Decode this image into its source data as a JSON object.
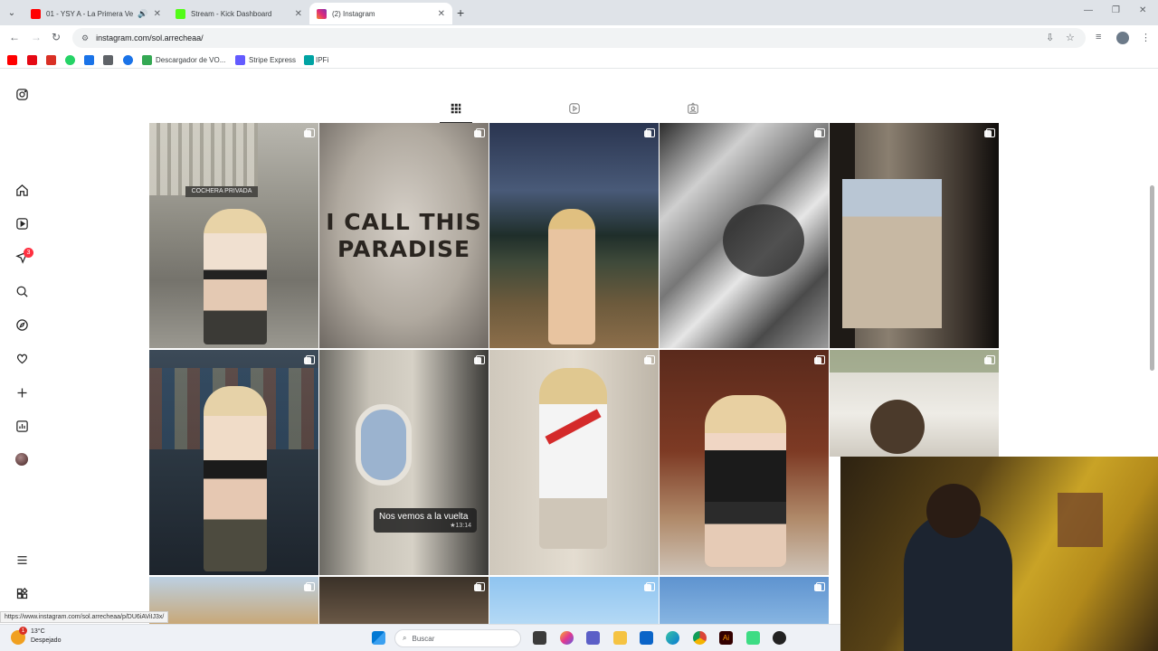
{
  "browser": {
    "tabs": [
      {
        "title": "01 - YSY A - La Primera Ve",
        "active": false,
        "favicon_color": "#ff0000"
      },
      {
        "title": "Stream - Kick Dashboard",
        "active": false,
        "favicon_color": "#53fc18"
      },
      {
        "title": "(2) Instagram",
        "active": true,
        "favicon_color": "#e1306c"
      }
    ],
    "url": "instagram.com/sol.arrecheaa/",
    "bookmarks": [
      {
        "label": "",
        "color": "#ff0000"
      },
      {
        "label": "",
        "color": "#e50914"
      },
      {
        "label": "",
        "color": "#d93025"
      },
      {
        "label": "",
        "color": "#25d366"
      },
      {
        "label": "",
        "color": "#1a73e8"
      },
      {
        "label": "",
        "color": "#5f6368"
      },
      {
        "label": "",
        "color": "#1a73e8"
      },
      {
        "label": "Descargador de VO...",
        "color": "#34a853"
      },
      {
        "label": "Stripe Express",
        "color": "#635bff"
      },
      {
        "label": "IPFi",
        "color": "#00a3a3"
      }
    ]
  },
  "instagram": {
    "sidebar": {
      "notification_count": "3"
    },
    "posts": [
      {
        "name": "post-1",
        "caption": ""
      },
      {
        "name": "post-2",
        "caption": "I CALL THIS PARADISE"
      },
      {
        "name": "post-3",
        "caption": ""
      },
      {
        "name": "post-4",
        "caption": ""
      },
      {
        "name": "post-5",
        "caption": ""
      },
      {
        "name": "post-6",
        "caption": ""
      },
      {
        "name": "post-7",
        "caption": "Nos vemos a la vuelta",
        "timestamp": "★13:14"
      },
      {
        "name": "post-8",
        "caption": ""
      },
      {
        "name": "post-9",
        "caption": ""
      },
      {
        "name": "post-10",
        "caption": ""
      }
    ]
  },
  "status_bar": {
    "url": "https://www.instagram.com/sol.arrecheaa/p/DU6iAViIJ3x/"
  },
  "taskbar": {
    "weather_temp": "13°C",
    "weather_desc": "Despejado",
    "weather_badge": "1",
    "search_placeholder": "Buscar"
  }
}
